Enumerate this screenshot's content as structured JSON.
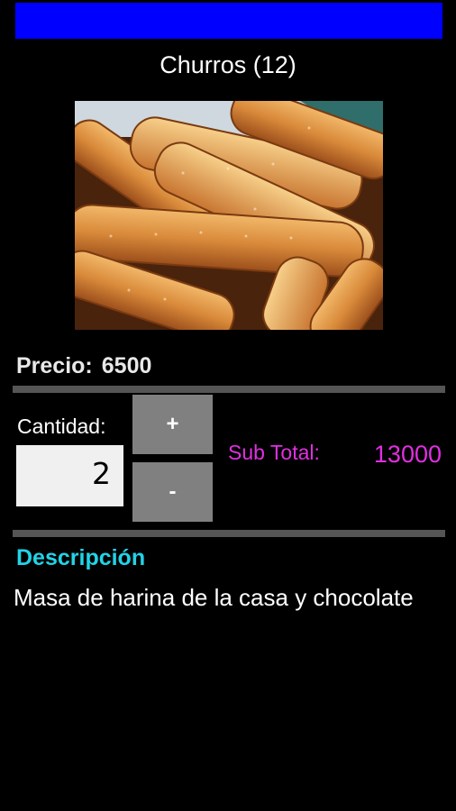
{
  "header": {
    "bar_color": "#0000ff"
  },
  "product": {
    "title": "Churros (12)",
    "image_icon": "churros-photo",
    "price_label": "Precio:",
    "price_value": "6500"
  },
  "quantity": {
    "label": "Cantidad:",
    "value": "2",
    "plus_label": "+",
    "minus_label": "-"
  },
  "subtotal": {
    "label": "Sub Total:",
    "value": "13000",
    "color": "#e030e0"
  },
  "description": {
    "heading": "Descripción",
    "text": "Masa de harina de la casa y chocolate",
    "heading_color": "#22d3e6"
  }
}
